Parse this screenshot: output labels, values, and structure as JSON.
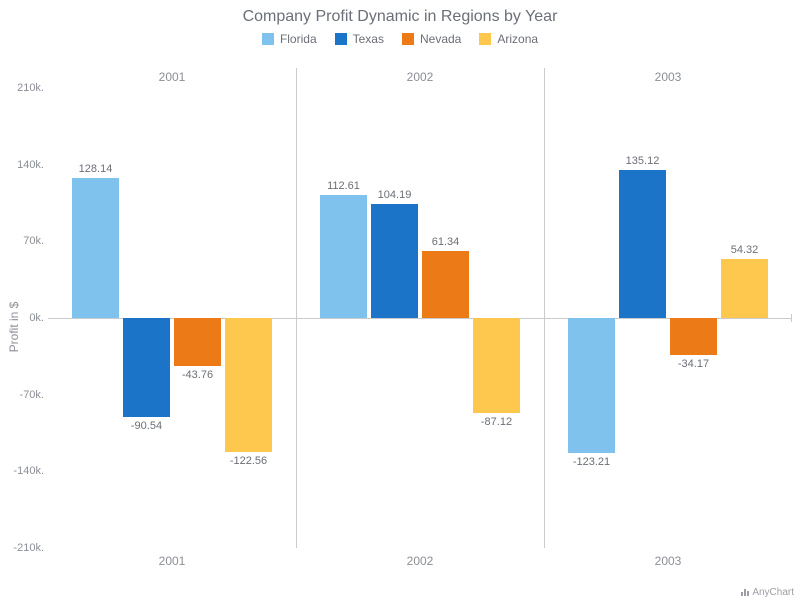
{
  "title": "Company Profit Dynamic in Regions by Year",
  "ylabel": "Profit in $",
  "credits": "AnyChart",
  "legend": [
    {
      "name": "Florida",
      "color": "#7ec2ed"
    },
    {
      "name": "Texas",
      "color": "#1b74c7"
    },
    {
      "name": "Nevada",
      "color": "#ec7a16"
    },
    {
      "name": "Arizona",
      "color": "#fec84e"
    }
  ],
  "y_ticks": [
    "210k.",
    "140k.",
    "70k.",
    "0k.",
    "-70k.",
    "-140k.",
    "-210k."
  ],
  "panels": [
    "2001",
    "2002",
    "2003"
  ],
  "chart_data": {
    "type": "bar",
    "title": "Company Profit Dynamic in Regions by Year",
    "xlabel": "",
    "ylabel": "Profit in $",
    "ylim": [
      -210000,
      210000
    ],
    "facets": [
      "2001",
      "2002",
      "2003"
    ],
    "categories": [
      "Florida",
      "Texas",
      "Nevada",
      "Arizona"
    ],
    "series": [
      {
        "name": "Florida",
        "color": "#7ec2ed",
        "values": [
          128140,
          112610,
          -123210
        ]
      },
      {
        "name": "Texas",
        "color": "#1b74c7",
        "values": [
          -90540,
          104190,
          135120
        ]
      },
      {
        "name": "Nevada",
        "color": "#ec7a16",
        "values": [
          -43760,
          61340,
          -34170
        ]
      },
      {
        "name": "Arizona",
        "color": "#fec84e",
        "values": [
          -122560,
          -87120,
          54320
        ]
      }
    ],
    "value_labels": [
      [
        "128.14",
        "-90.54",
        "-43.76",
        "-122.56"
      ],
      [
        "112.61",
        "104.19",
        "61.34",
        "-87.12"
      ],
      [
        "-123.21",
        "135.12",
        "-34.17",
        "54.32"
      ]
    ]
  }
}
